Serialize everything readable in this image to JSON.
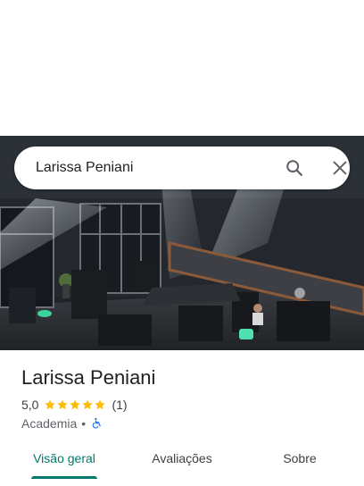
{
  "search": {
    "query": "Larissa Peniani",
    "search_icon": "search-icon",
    "close_icon": "close-icon"
  },
  "place": {
    "name": "Larissa Peniani",
    "rating": "5,0",
    "stars": 5,
    "review_count": "(1)",
    "category": "Academia",
    "separator": "•",
    "accessibility_icon": "wheelchair-icon"
  },
  "tabs": [
    {
      "label": "Visão geral",
      "active": true
    },
    {
      "label": "Avaliações",
      "active": false
    },
    {
      "label": "Sobre",
      "active": false
    }
  ],
  "colors": {
    "accent": "#00796b",
    "star": "#fbbc04",
    "accessibility": "#1a73e8"
  }
}
